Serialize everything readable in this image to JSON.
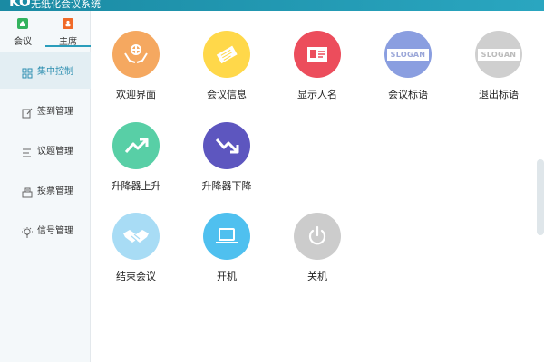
{
  "window": {
    "logo_text": "KO",
    "title": "无纸化会议系统"
  },
  "sidebar": {
    "role_tabs": [
      {
        "label": "会议",
        "icon": "home-icon",
        "color": "#33b35e"
      },
      {
        "label": "主席",
        "icon": "chair-person-icon",
        "color": "#f06a28"
      }
    ],
    "items": [
      {
        "label": "集中控制",
        "icon": "grid-icon",
        "active": true
      },
      {
        "label": "签到管理",
        "icon": "edit-icon"
      },
      {
        "label": "议题管理",
        "icon": "list-icon"
      },
      {
        "label": "投票管理",
        "icon": "ballot-icon"
      },
      {
        "label": "信号管理",
        "icon": "signal-icon"
      }
    ]
  },
  "main": {
    "tiles": [
      {
        "label": "欢迎界面",
        "icon": "globe-hands-icon",
        "color": "#f5a860"
      },
      {
        "label": "会议信息",
        "icon": "ticket-icon",
        "color": "#ffd84a"
      },
      {
        "label": "显示人名",
        "icon": "name-card-icon",
        "color": "#ec4d5c"
      },
      {
        "label": "会议标语",
        "icon": "slogan-icon",
        "color": "#8a9ee0",
        "badge": "SLOGAN"
      },
      {
        "label": "退出标语",
        "icon": "slogan-off-icon",
        "color": "#cfcfcf",
        "badge": "SLOGAN"
      },
      {
        "label": "升降器上升",
        "icon": "trend-up-icon",
        "color": "#58cfa6"
      },
      {
        "label": "升降器下降",
        "icon": "trend-down-icon",
        "color": "#5d56bf"
      },
      {
        "label": "结束会议",
        "icon": "handshake-icon",
        "color": "#a8dcf5"
      },
      {
        "label": "开机",
        "icon": "laptop-icon",
        "color": "#4fc0ef"
      },
      {
        "label": "关机",
        "icon": "power-icon",
        "color": "#cccccc"
      }
    ]
  }
}
